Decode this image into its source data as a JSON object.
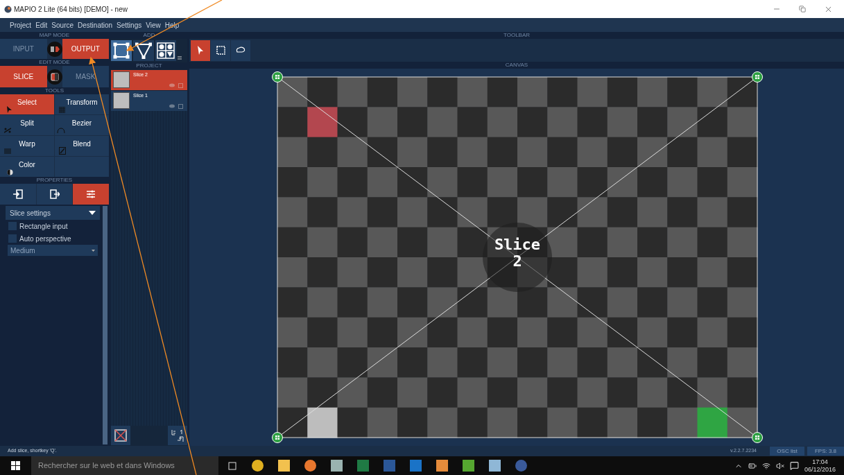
{
  "window": {
    "title": "MAPIO 2 Lite (64 bits) [DEMO] - new"
  },
  "menu": [
    "Project",
    "Edit",
    "Source",
    "Destination",
    "Settings",
    "View",
    "Help"
  ],
  "map_mode": {
    "label": "MAP MODE",
    "options": [
      {
        "label": "INPUT",
        "selected": false
      },
      {
        "label": "OUTPUT",
        "selected": true
      }
    ]
  },
  "edit_mode": {
    "label": "EDIT MODE",
    "options": [
      {
        "label": "SLICE",
        "selected": true
      },
      {
        "label": "MASK",
        "selected": false
      }
    ]
  },
  "tools": {
    "label": "TOOLS",
    "items": [
      {
        "label": "Select",
        "kind": "select",
        "selected": true
      },
      {
        "label": "Transform",
        "kind": "transform",
        "selected": false
      },
      {
        "label": "Split",
        "kind": "split",
        "selected": false
      },
      {
        "label": "Bezier",
        "kind": "bezier",
        "selected": false
      },
      {
        "label": "Warp",
        "kind": "warp",
        "selected": false
      },
      {
        "label": "Blend",
        "kind": "blend",
        "selected": false
      },
      {
        "label": "Color",
        "kind": "color",
        "selected": false
      }
    ]
  },
  "properties": {
    "label": "PROPERTIES",
    "tabs": [
      {
        "kind": "input",
        "selected": false
      },
      {
        "kind": "output",
        "selected": false
      },
      {
        "kind": "settings",
        "selected": true
      }
    ],
    "section": "Slice settings",
    "options": [
      {
        "label": "Rectangle input",
        "checked": false
      },
      {
        "label": "Auto perspective",
        "checked": false
      }
    ],
    "quality": "Medium"
  },
  "add": {
    "label": "ADD",
    "buttons": [
      {
        "kind": "rectangle",
        "selected": true
      },
      {
        "kind": "triangle",
        "selected": false
      },
      {
        "kind": "grid",
        "selected": false
      }
    ]
  },
  "project": {
    "label": "PROJECT",
    "slices": [
      {
        "name": "Slice 2",
        "selected": true
      },
      {
        "name": "Slice 1",
        "selected": false
      }
    ]
  },
  "toolbar": {
    "label": "TOOLBAR",
    "buttons": [
      {
        "kind": "pointer",
        "selected": true
      },
      {
        "kind": "rect-select",
        "selected": false
      },
      {
        "kind": "lasso",
        "selected": false
      }
    ]
  },
  "canvas": {
    "label": "CANVAS",
    "slice_label": "Slice 2"
  },
  "status_bar": {
    "hint": "Add slice, shortkey 'Q'.",
    "version": "v.2.2.7.2234",
    "osc": "OSC list",
    "fps": "FPS: 3.8"
  },
  "taskbar": {
    "search_placeholder": "Rechercher sur le web et dans Windows",
    "time": "17:04",
    "date": "06/12/2016"
  }
}
